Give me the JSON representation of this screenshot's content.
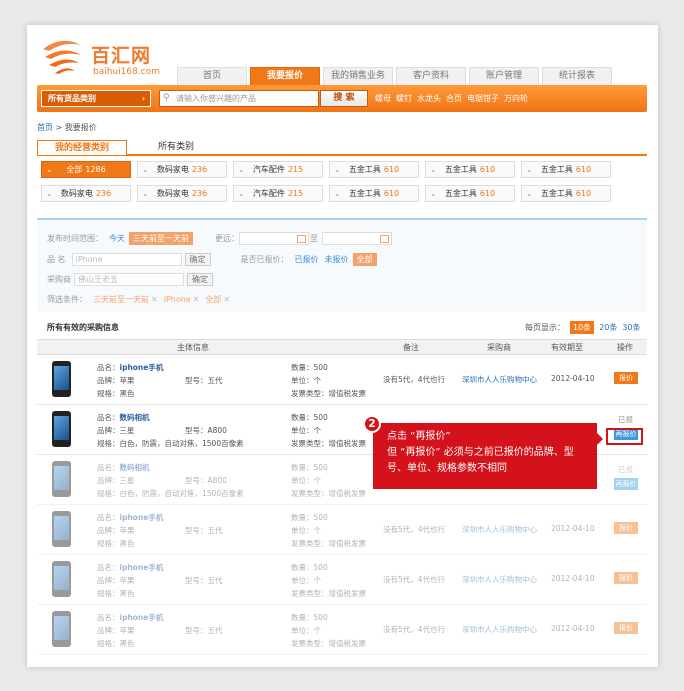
{
  "logo": {
    "name": "百汇网",
    "domain": "baihui168.com"
  },
  "nav": {
    "tabs": [
      {
        "label": "首页",
        "active": false
      },
      {
        "label": "我要报价",
        "active": true
      },
      {
        "label": "我的销售业务",
        "active": false
      },
      {
        "label": "客户资料",
        "active": false
      },
      {
        "label": "账户管理",
        "active": false
      },
      {
        "label": "统计报表",
        "active": false
      }
    ]
  },
  "search": {
    "category_label": "所有货品类别",
    "placeholder": "请输入你感兴趣的产品",
    "button": "搜 索",
    "hot_keywords": [
      "螺母",
      "螺钉",
      "水龙头",
      "合页",
      "电锯钳子",
      "万向轮"
    ]
  },
  "breadcrumb": {
    "home": "首页",
    "sep": ">",
    "current": "我要报价"
  },
  "category_tabs": [
    {
      "label": "我的经营类别",
      "active": true
    },
    {
      "label": "所有类别",
      "active": false
    }
  ],
  "category_chips": [
    {
      "label": "全部",
      "count": "1286",
      "active": true
    },
    {
      "label": "数码家电",
      "count": "236"
    },
    {
      "label": "数码家电",
      "count": "236"
    },
    {
      "label": "汽车配件",
      "count": "215"
    },
    {
      "label": "五金工具",
      "count": "610"
    },
    {
      "label": "五金工具",
      "count": "610"
    },
    {
      "label": "五金工具",
      "count": "610"
    },
    {
      "label": "数码家电",
      "count": "236"
    },
    {
      "label": "数码家电",
      "count": "236"
    },
    {
      "label": "汽车配件",
      "count": "215"
    },
    {
      "label": "五金工具",
      "count": "610"
    },
    {
      "label": "五金工具",
      "count": "610"
    },
    {
      "label": "五金工具",
      "count": "610"
    }
  ],
  "filters": {
    "publish_label": "发布时间范围：",
    "publish_today": "今天",
    "publish_range": "三天前至一天前",
    "custom_label": "更远：",
    "to": "至",
    "name_label": "品    名",
    "name_value": "iPhone",
    "confirm": "确定",
    "quoted_label": "是否已报价：",
    "quoted_yes": "已报价",
    "quoted_no": "未报价",
    "quoted_all": "全部",
    "buyer_label": "采购商",
    "buyer_value": "佛山王老五",
    "cond_label": "筛选条件：",
    "conditions": [
      "三天前至一天前",
      "iPhone",
      "全部"
    ]
  },
  "list": {
    "title": "所有有效的采购信息",
    "perpage_label": "每页显示：",
    "perpage_options": [
      "10条",
      "20条",
      "30条"
    ],
    "headers": {
      "main": "主体信息",
      "note": "备注",
      "buyer": "采购商",
      "expiry": "有效期至",
      "action": "操作"
    }
  },
  "rows": [
    {
      "name_label": "品名：",
      "name": "iphone手机",
      "brand": "品牌：苹果",
      "color": "规格：黑色",
      "model": "型号：五代",
      "qty": "数量：500",
      "unit": "单位：个",
      "invoice": "发票类型：增值税发票",
      "note": "没有5代，4代也行",
      "buyer": "深圳市人人乐购物中心",
      "expiry": "2012-04-10",
      "action": "报价"
    },
    {
      "name_label": "品名：",
      "name": "数码相机",
      "brand": "品牌：三星",
      "color": "规格：白色，防震，自动对焦，1500百像素",
      "model": "型号：A800",
      "qty": "数量：500",
      "unit": "单位：个",
      "invoice": "发票类型：增值税发票",
      "status": "已报",
      "action": "再报价"
    },
    {
      "name_label": "品名：",
      "name": "数码相机",
      "brand": "品牌：三星",
      "color": "规格：白色，防震，自动对焦，1500百像素",
      "model": "型号：A800",
      "qty": "数量：500",
      "unit": "单位：个",
      "invoice": "发票类型：增值税发票",
      "status": "已报",
      "action": "再报价"
    },
    {
      "name_label": "品名：",
      "name": "iphone手机",
      "brand": "品牌：苹果",
      "color": "规格：黑色",
      "model": "型号：五代",
      "qty": "数量：500",
      "unit": "单位：个",
      "invoice": "发票类型：增值税发票",
      "note": "没有5代，4代也行",
      "buyer": "深圳市人人乐购物中心",
      "expiry": "2012-04-10",
      "action": "报价"
    },
    {
      "name_label": "品名：",
      "name": "iphone手机",
      "brand": "品牌：苹果",
      "color": "规格：黑色",
      "model": "型号：五代",
      "qty": "数量：500",
      "unit": "单位：个",
      "invoice": "发票类型：增值税发票",
      "note": "没有5代，4代也行",
      "buyer": "深圳市人人乐购物中心",
      "expiry": "2012-04-10",
      "action": "报价"
    },
    {
      "name_label": "品名：",
      "name": "iphone手机",
      "brand": "品牌：苹果",
      "color": "规格：黑色",
      "model": "型号：五代",
      "qty": "数量：500",
      "unit": "单位：个",
      "invoice": "发票类型：增值税发票",
      "note": "没有5代，4代也行",
      "buyer": "深圳市人人乐购物中心",
      "expiry": "2012-04-10",
      "action": "报价"
    }
  ],
  "callout": {
    "number": "2",
    "line1": "点击 “再报价”",
    "line2": "但 “再报价” 必须与之前已报价的品牌、型号、单位、规格参数不相同"
  },
  "colors": {
    "accent": "#f07817",
    "link": "#2a6fb0",
    "callout": "#d3121b"
  }
}
